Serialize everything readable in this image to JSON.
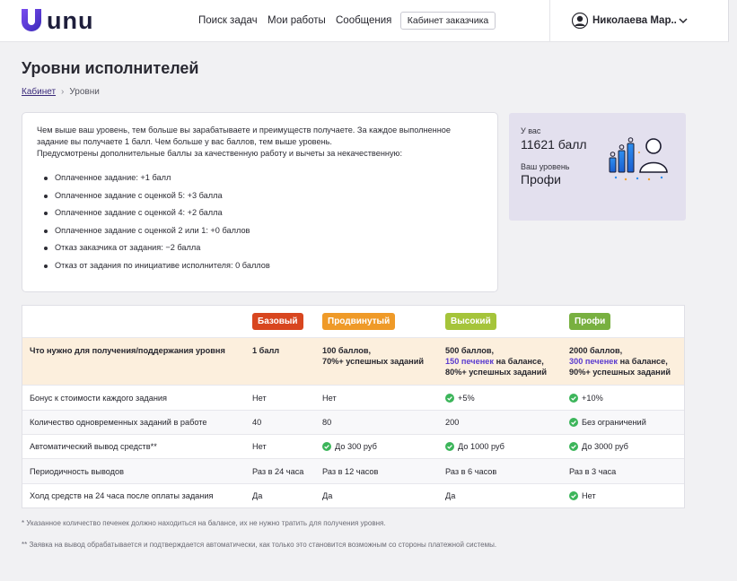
{
  "header": {
    "logo_text": "unu",
    "nav": [
      "Поиск задач",
      "Мои работы",
      "Сообщения"
    ],
    "cabinet_button": "Кабинет заказчика",
    "user_name": "Николаева Мар.."
  },
  "page": {
    "title": "Уровни исполнителей",
    "breadcrumb": {
      "home": "Кабинет",
      "current": "Уровни"
    }
  },
  "info": {
    "paragraph1": "Чем выше ваш уровень, тем больше вы зарабатываете и преимуществ получаете. За каждое выполненное задание вы получаете 1 балл. Чем больше у вас баллов, тем выше уровень.",
    "paragraph2": "Предусмотрены дополнительные баллы за качественную работу и вычеты за некачественную:",
    "bullets": [
      "Оплаченное задание: +1 балл",
      "Оплаченное задание с оценкой 5: +3 балла",
      "Оплаченное задание с оценкой 4: +2 балла",
      "Оплаченное задание с оценкой 2 или 1: +0 баллов",
      "Отказ заказчика от задания: −2 балла",
      "Отказ от задания по инициативе исполнителя: 0 баллов"
    ]
  },
  "side": {
    "you_have_label": "У вас",
    "points": "11621 балл",
    "level_label": "Ваш уровень",
    "level": "Профи"
  },
  "table": {
    "levels": [
      {
        "name": "Базовый",
        "color": "#d8461f"
      },
      {
        "name": "Продвинутый",
        "color": "#ef9a28"
      },
      {
        "name": "Высокий",
        "color": "#a5c43a"
      },
      {
        "name": "Профи",
        "color": "#78b040"
      }
    ],
    "rows": [
      {
        "label": "Что нужно для получения/поддержания уровня",
        "highlight": true,
        "cells": [
          {
            "lines": [
              "1 балл"
            ]
          },
          {
            "lines": [
              "100 баллов,",
              "70%+ успешных заданий"
            ]
          },
          {
            "lines": [
              "500 баллов,",
              {
                "accent": "150 печенек",
                "rest": " на балансе,"
              },
              "80%+ успешных заданий"
            ]
          },
          {
            "lines": [
              "2000 баллов,",
              {
                "accent": "300 печенек",
                "rest": " на балансе,"
              },
              "90%+ успешных заданий"
            ]
          }
        ]
      },
      {
        "label": "Бонус к стоимости каждого задания",
        "cells": [
          {
            "lines": [
              "Нет"
            ]
          },
          {
            "lines": [
              "Нет"
            ]
          },
          {
            "lines": [
              "+5%"
            ],
            "check": true
          },
          {
            "lines": [
              "+10%"
            ],
            "check": true
          }
        ]
      },
      {
        "label": "Количество одновременных заданий в работе",
        "stripe": true,
        "cells": [
          {
            "lines": [
              "40"
            ]
          },
          {
            "lines": [
              "80"
            ]
          },
          {
            "lines": [
              "200"
            ]
          },
          {
            "lines": [
              "Без ограничений"
            ],
            "check": true
          }
        ]
      },
      {
        "label": "Автоматический вывод средств**",
        "cells": [
          {
            "lines": [
              "Нет"
            ]
          },
          {
            "lines": [
              "До 300 руб"
            ],
            "check": true
          },
          {
            "lines": [
              "До 1000 руб"
            ],
            "check": true
          },
          {
            "lines": [
              "До 3000 руб"
            ],
            "check": true
          }
        ]
      },
      {
        "label": "Периодичность выводов",
        "stripe": true,
        "cells": [
          {
            "lines": [
              "Раз в 24 часа"
            ]
          },
          {
            "lines": [
              "Раз в 12 часов"
            ]
          },
          {
            "lines": [
              "Раз в 6 часов"
            ]
          },
          {
            "lines": [
              "Раз в 3 часа"
            ]
          }
        ]
      },
      {
        "label": "Холд средств на 24 часа после оплаты задания",
        "cells": [
          {
            "lines": [
              "Да"
            ]
          },
          {
            "lines": [
              "Да"
            ]
          },
          {
            "lines": [
              "Да"
            ]
          },
          {
            "lines": [
              "Нет"
            ],
            "check": true
          }
        ]
      }
    ]
  },
  "footnotes": [
    "* Указанное количество печенек должно находиться на балансе, их не нужно тратить для получения уровня.",
    "** Заявка на вывод обрабатывается и подтверждается автоматически, как только это становится возможным со стороны платежной системы."
  ],
  "colors": {
    "accent": "#5b3ccf",
    "check": "#3cb55a",
    "side_card": "#e3e0ee",
    "highlight_row": "#fcefdd"
  }
}
